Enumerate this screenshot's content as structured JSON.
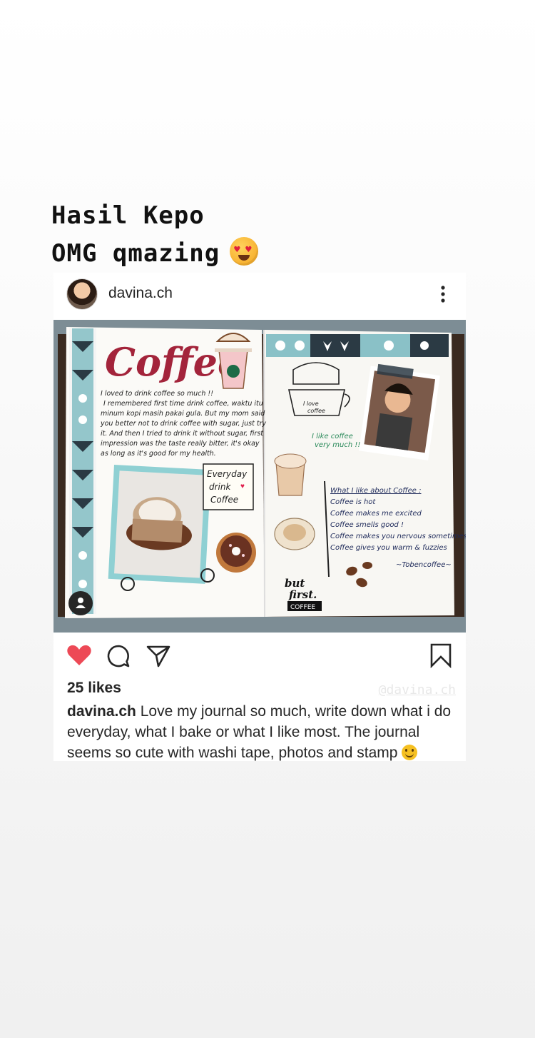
{
  "story": {
    "line1": "Hasil Kepo",
    "line2": "OMG qmazing"
  },
  "post": {
    "username": "davina.ch",
    "likes": "25 likes",
    "watermark": "@davina.ch",
    "caption_user": "davina.ch",
    "caption_text": " Love my journal so much, write down what i do everyday, what I bake or what I like most. The journal seems so cute with washi tape, photos and stamp ",
    "liked": true,
    "heart_color": "#ed4956"
  },
  "journal": {
    "title": "Coffee",
    "intro": [
      "I loved to drink coffee so much !!",
      "I remembered first time drink coffee, waktu itu",
      "minum kopi masih pakai gula. But my mom said",
      "you better not to drink coffee with sugar, just try",
      "it. And then I tried to drink it without sugar, first",
      "impression was the taste really bitter, it's okay",
      "as long as it's good for my health."
    ],
    "everyday_label": [
      "Everyday",
      "drink",
      "Coffee"
    ],
    "doodle_label": [
      "I love",
      "coffee"
    ],
    "like_note": [
      "I like coffee",
      "very much !!"
    ],
    "likes_title": "What I like about Coffee :",
    "likes_list": [
      "Coffee is hot",
      "Coffee makes me excited",
      "Coffee smells good !",
      "Coffee makes you nervous sometimes",
      "Coffee gives you warm & fuzzies"
    ],
    "signature": "~Tobencoffee~",
    "stamp_line1": "but",
    "stamp_line2": "first.",
    "stamp_badge": "COFFEE"
  }
}
